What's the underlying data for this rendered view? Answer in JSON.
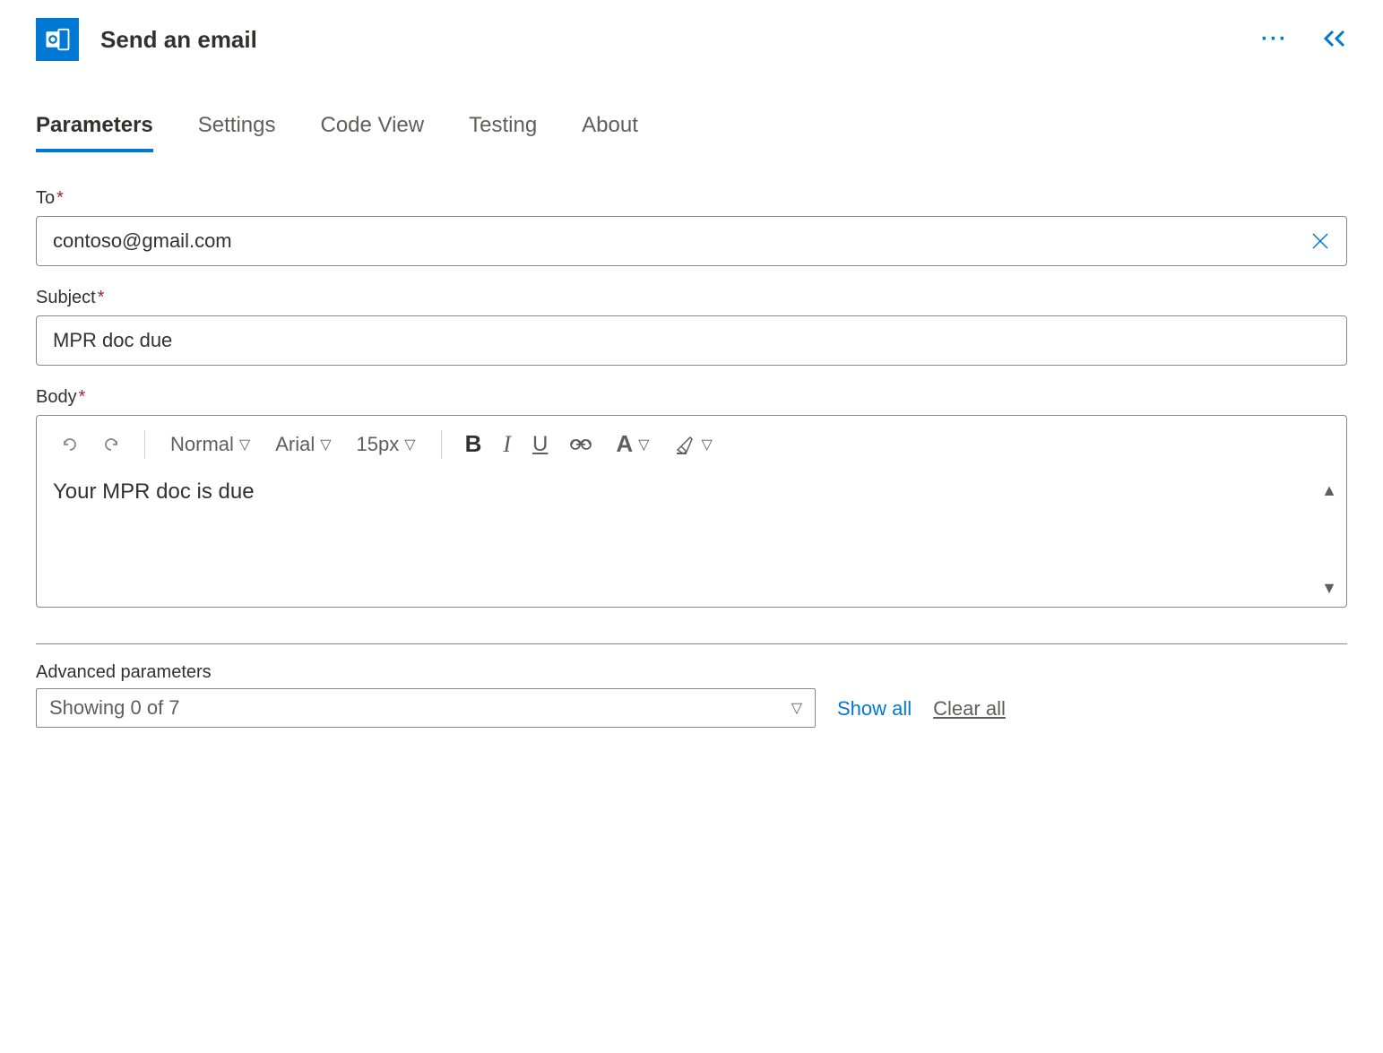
{
  "header": {
    "title": "Send an email"
  },
  "tabs": [
    {
      "label": "Parameters",
      "active": true
    },
    {
      "label": "Settings",
      "active": false
    },
    {
      "label": "Code View",
      "active": false
    },
    {
      "label": "Testing",
      "active": false
    },
    {
      "label": "About",
      "active": false
    }
  ],
  "fields": {
    "to": {
      "label": "To",
      "value": "contoso@gmail.com"
    },
    "subject": {
      "label": "Subject",
      "value": "MPR doc due"
    },
    "body": {
      "label": "Body",
      "value": "Your MPR doc is due"
    }
  },
  "editor_toolbar": {
    "format": "Normal",
    "font": "Arial",
    "size": "15px"
  },
  "advanced": {
    "label": "Advanced parameters",
    "showing_text": "Showing 0 of 7",
    "show_all": "Show all",
    "clear_all": "Clear all"
  }
}
